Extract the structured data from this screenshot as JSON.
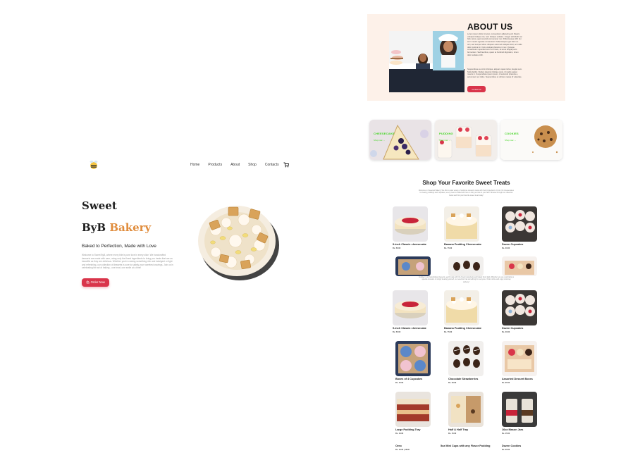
{
  "nav": {
    "logo_icon": "bee-logo-icon",
    "links": [
      "Home",
      "Products",
      "About",
      "Shop",
      "Contacts"
    ],
    "cart_icon": "cart-icon"
  },
  "hero": {
    "title_line1": "Sweet",
    "title_line2_a": "ByB",
    "title_line2_b": "Bakery",
    "tagline": "Baked to Perfection, Made with Love",
    "description": "Welcome to Sweet ByB, where every bite is pure love in every slice. We handcrafted desserts are made with care, using only the finest ingredients to bring you treats that are as beautiful as they are delicious. Whether you're craving something rich and indulgent or light and refreshing, our collection of desserts is sure to satisfy your sweetest cravings. Join us in celebrating the art of baking - one treat, one smile at a time!",
    "order_button": "🛍 Order Now",
    "accent_color": "#e08c3c",
    "button_color": "#d9344a"
  },
  "about": {
    "title": "ABOUT US",
    "paragraph1": "Lorem ipsum dolor sit amet, consectetur adipiscing elit. Mauris volutpat tristique nisi, nam tristique sodales. Integer sollicitudin ac felis varius, eget suscipit erat semper nec. Pellentesque nibh dui sit in mauris egestas consectetur. Pellentesque eget diam eu orci, sed semper tellus. Aliquam euismod volutpat dolor, ac mollis dolor pulvinar in. Duis volutpat pharetra mi nec. Quisque consectetur imperdiet tortor et ornare, sit amet feugiat justo fermentum. Sed faucibus, quam at hendrerit dignissim, lorem dolor sodales nibh.",
    "paragraph2": "Suspendisse eu tortor tristique, aliquam quam tellus, feugiat sem. Nulla facilisi. Nullam placerat tristique justo, id mattis sapien mauris in. Suspendisse ipsum ipsum, id euismod pharetra a, accumsan nec tellus. Suspendisse et ultrices massa id vulputate.",
    "contact_button": "Contact us",
    "background": "#fdf1e9"
  },
  "categories": [
    {
      "label": "CHEESECAKE",
      "link": "Shop now →"
    },
    {
      "label": "PUDDING",
      "link": "Shop now →"
    },
    {
      "label": "COOKIES",
      "link": "Shop now →"
    }
  ],
  "shop": {
    "title": "Shop Your Favorite Sweet Treats",
    "description": "Welcome to Sweetest Bakery! We offer a wide variety of delicious desserts made with fresh ingredients. From rich cheesecakes to creamy puddings and cupcakes, every treat is crafted with love to bring a smile to your face. Browse through our collection below and find your favorite sweet treat today!",
    "description2": "Indulge in our handcrafted desserts, each made with the finest ingredients and baked fresh daily. Whether you are celebrating a special occasion or simply treating yourself, our selection has something for everyone. Order online and enjoy doorstep delivery!",
    "products_top": [
      {
        "name": "9-inch Classic cheesecake",
        "price": "Rs. 50.00"
      },
      {
        "name": "Banana Pudding Cheesecake",
        "price": "Rs. 75.00"
      },
      {
        "name": "Dozen Cupcakes",
        "price": "Rs. 40.00"
      }
    ],
    "products_main": [
      {
        "name": "9-inch Classic cheesecake",
        "price": "Rs. 50.00"
      },
      {
        "name": "Banana Pudding Cheesecake",
        "price": "Rs. 75.00"
      },
      {
        "name": "Dozen Cupcakes",
        "price": "Rs. 40.00"
      },
      {
        "name": "Boxes of 4 Cupcakes",
        "price": "Rs. 15.00"
      },
      {
        "name": "Chocolate Strawberries",
        "price": "Rs. 20.00"
      },
      {
        "name": "Assorted Dessert Boxes",
        "price": "Rs. 35.00"
      },
      {
        "name": "Large Pudding Tray",
        "price": "Rs. 10.00"
      },
      {
        "name": "Half & Half Tray",
        "price": "Rs. 15.00"
      },
      {
        "name": "16oz Mason Jars",
        "price": "Rs. 15.00"
      },
      {
        "name": "Oreo",
        "price": "Rs. 10.00 | 18.00"
      },
      {
        "name": "5oz Mini Cups with any Flavor Pudding",
        "price": ""
      },
      {
        "name": "Dozen Cookies",
        "price": "Rs. 20.00"
      }
    ]
  }
}
